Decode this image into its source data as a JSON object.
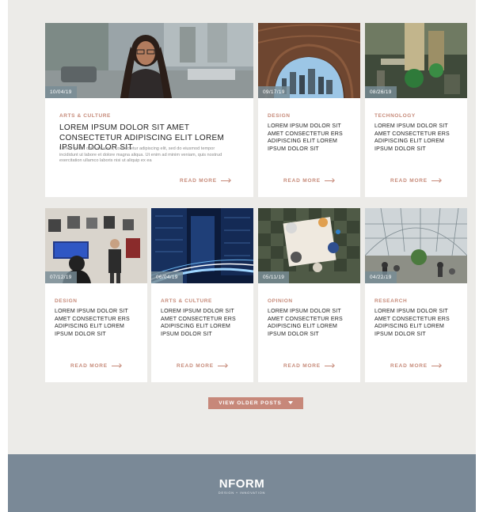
{
  "posts": [
    {
      "date": "10/04/19",
      "category": "ARTS & CULTURE",
      "title": "LOREM IPSUM DOLOR SIT AMET CONSECTETUR ADIPISCING ELIT LOREM IPSUM DOLOR SIT",
      "excerpt": "Lorem ipsum dolor sit amet, consectetur adipiscing elit, sed do eiusmod tempor incididunt ut labore et dolore magna aliqua. Ut enim ad minim veniam, quis nostrud exercitation ullamco laboris nisi ut aliquip ex ea",
      "read_more": "READ MORE"
    },
    {
      "date": "09/17/19",
      "category": "DESIGN",
      "title": "LOREM IPSUM DOLOR SIT AMET CONSECTETUR ERS ADIPISCING ELIT LOREM IPSUM DOLOR SIT",
      "read_more": "READ MORE"
    },
    {
      "date": "08/26/19",
      "category": "TECHNOLOGY",
      "title": "LOREM IPSUM DOLOR SIT AMET CONSECTETUR ERS ADIPISCING ELIT LOREM IPSUM DOLOR SIT",
      "read_more": "READ MORE"
    },
    {
      "date": "07/12/19",
      "category": "DESIGN",
      "title": "LOREM IPSUM DOLOR SIT AMET CONSECTETUR ERS ADIPISCING ELIT LOREM IPSUM DOLOR SIT",
      "read_more": "READ MORE"
    },
    {
      "date": "06/04/19",
      "category": "ARTS & CULTURE",
      "title": "LOREM IPSUM DOLOR SIT AMET CONSECTETUR ERS ADIPISCING ELIT LOREM IPSUM DOLOR SIT",
      "read_more": "READ MORE"
    },
    {
      "date": "05/11/19",
      "category": "OPINION",
      "title": "LOREM IPSUM DOLOR SIT AMET CONSECTETUR ERS ADIPISCING ELIT LOREM IPSUM DOLOR SIT",
      "read_more": "READ MORE"
    },
    {
      "date": "04/22/19",
      "category": "RESEARCH",
      "title": "LOREM IPSUM DOLOR SIT AMET CONSECTETUR ERS ADIPISCING ELIT LOREM IPSUM DOLOR SIT",
      "read_more": "READ MORE"
    }
  ],
  "older_posts_label": "VIEW OLDER POSTS",
  "footer": {
    "logo": "NFORM",
    "tagline": "DESIGN + INNOVATION"
  },
  "colors": {
    "accent": "#c68a79",
    "footer": "#7a8997",
    "background": "#ecebe8",
    "date_badge": "#788c96"
  }
}
